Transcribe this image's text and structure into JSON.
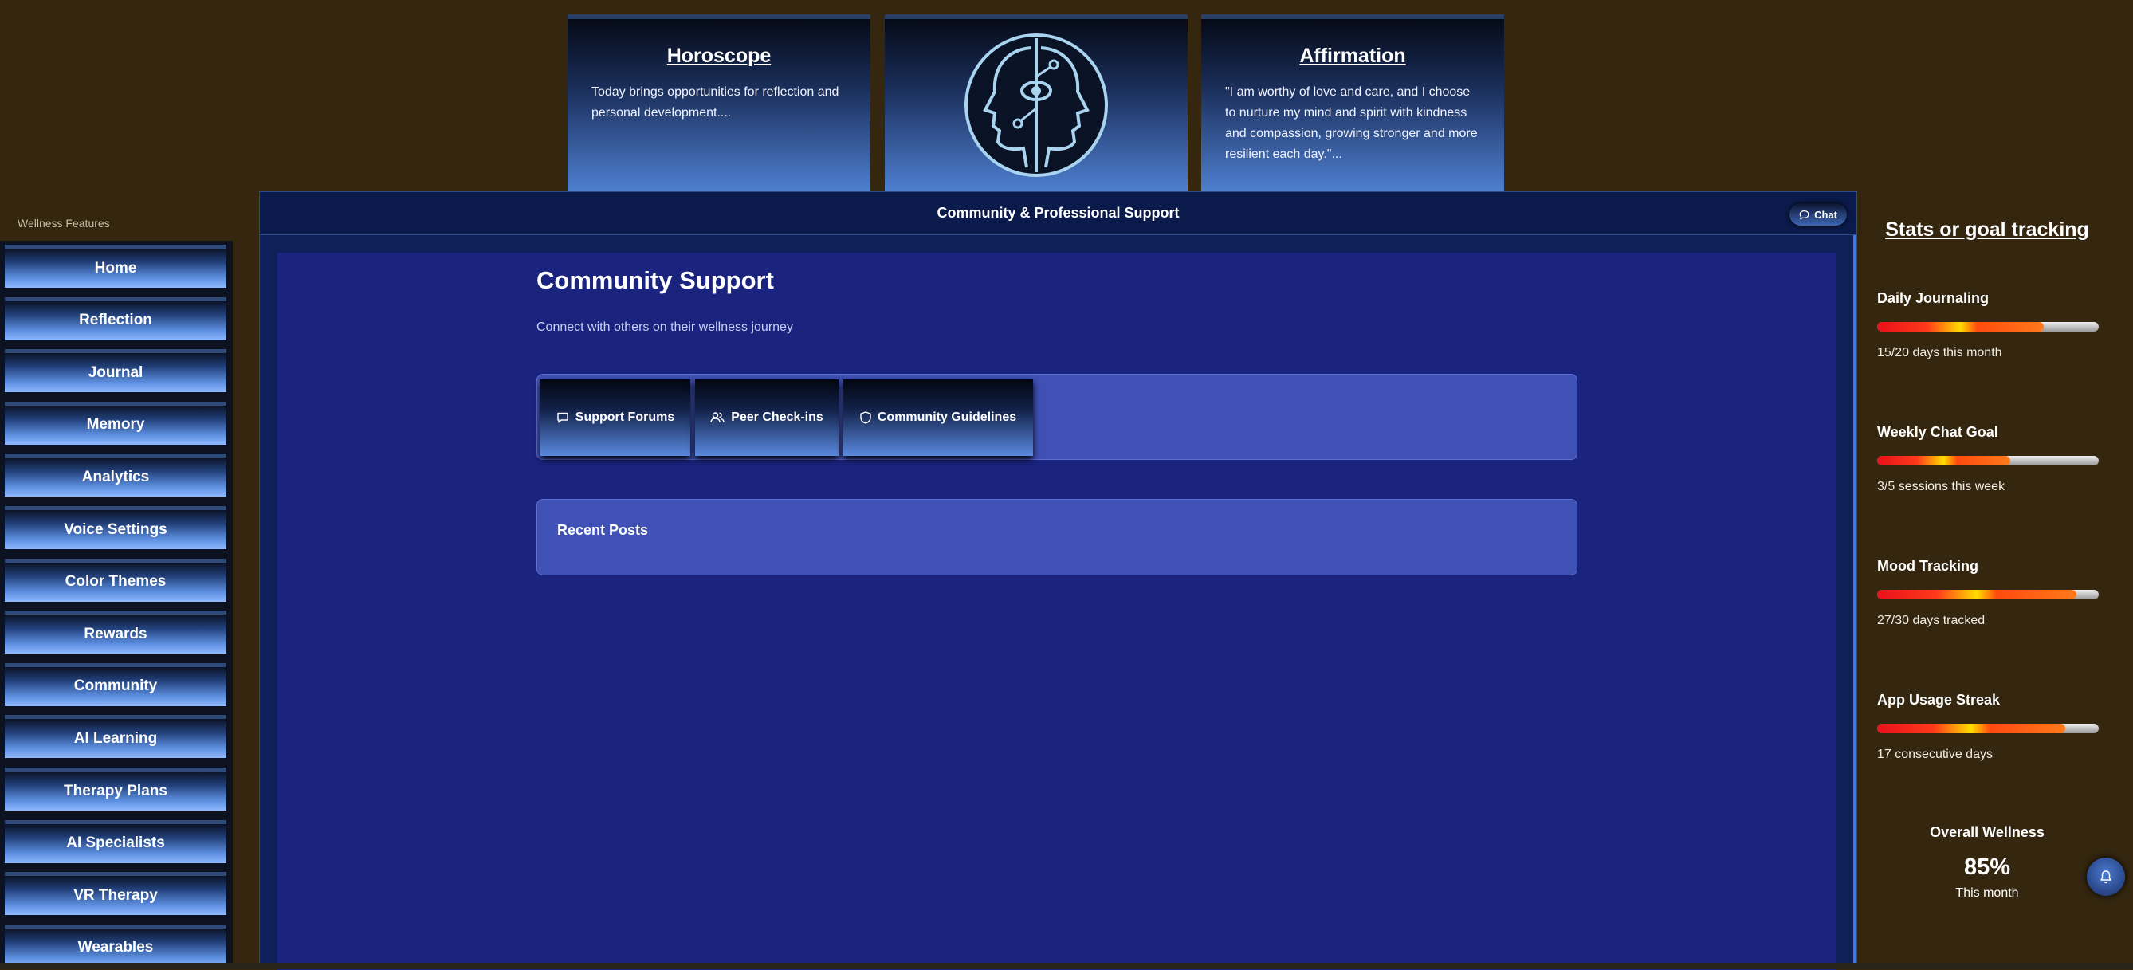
{
  "top_cards": {
    "horoscope": {
      "title": "Horoscope",
      "text": "Today brings opportunities for reflection and personal development...."
    },
    "logo": {
      "icon": "two-faces-eye-logo"
    },
    "affirmation": {
      "title": "Affirmation",
      "text": "\"I am worthy of love and care, and I choose to nurture my mind and spirit with kindness and compassion, growing stronger and more resilient each day.\"..."
    }
  },
  "sidebar": {
    "title": "Wellness Features",
    "items": [
      {
        "label": "Home"
      },
      {
        "label": "Reflection"
      },
      {
        "label": "Journal"
      },
      {
        "label": "Memory"
      },
      {
        "label": "Analytics"
      },
      {
        "label": "Voice Settings"
      },
      {
        "label": "Color Themes"
      },
      {
        "label": "Rewards"
      },
      {
        "label": "Community"
      },
      {
        "label": "AI Learning"
      },
      {
        "label": "Therapy Plans"
      },
      {
        "label": "AI Specialists"
      },
      {
        "label": "VR Therapy"
      },
      {
        "label": "Wearables"
      }
    ]
  },
  "panel": {
    "header_title": "Community & Professional Support",
    "chat_label": "Chat",
    "section_title": "Community Support",
    "section_subtitle": "Connect with others on their wellness journey",
    "tabs": [
      {
        "label": "Support Forums",
        "icon": "message-square-icon"
      },
      {
        "label": "Peer Check-ins",
        "icon": "users-icon"
      },
      {
        "label": "Community Guidelines",
        "icon": "shield-icon"
      }
    ],
    "recent_posts_title": "Recent Posts"
  },
  "stats": {
    "title": "Stats or goal tracking",
    "items": [
      {
        "label": "Daily Journaling",
        "detail": "15/20 days this month",
        "progress": 0.75
      },
      {
        "label": "Weekly Chat Goal",
        "detail": "3/5 sessions this week",
        "progress": 0.6
      },
      {
        "label": "Mood Tracking",
        "detail": "27/30 days tracked",
        "progress": 0.9
      },
      {
        "label": "App Usage Streak",
        "detail": "17 consecutive days",
        "progress": 0.85
      }
    ],
    "overall_label": "Overall Wellness",
    "overall_value": "85%",
    "overall_sub": "This month"
  },
  "colors": {
    "background": "#34260f",
    "panel": "#0f1f57",
    "panel_body": "#1a237e",
    "card": "#3f51b5",
    "accent": "#5a8ae0"
  }
}
